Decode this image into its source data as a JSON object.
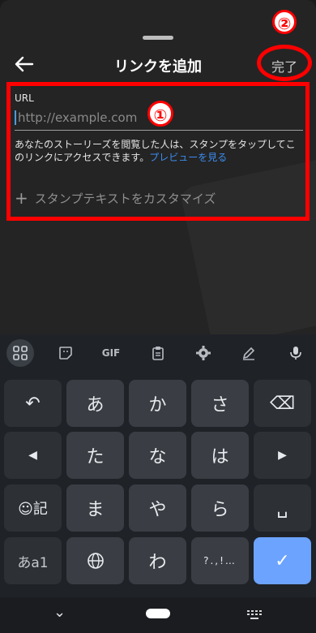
{
  "header": {
    "title": "リンクを追加",
    "done_label": "完了",
    "annotation_2": "②"
  },
  "url_field": {
    "label": "URL",
    "placeholder": "http://example.com",
    "annotation_1": "①"
  },
  "description": {
    "text": "あなたのストーリーズを閲覧した人は、スタンプをタップしてこのリンクにアクセスできます。",
    "link_text": "プレビューを見る"
  },
  "customize": {
    "label": "スタンプテキストをカスタマイズ"
  },
  "keyboard": {
    "toolbar": [
      "grid-icon",
      "sticker-icon",
      "GIF",
      "clipboard-icon",
      "settings-icon",
      "pen-icon",
      "mic-icon"
    ],
    "keys": {
      "undo": "↶",
      "a": "あ",
      "ka": "か",
      "sa": "さ",
      "backspace": "⌫",
      "left": "◀",
      "ta": "た",
      "na": "な",
      "ha": "は",
      "right": "▶",
      "emoji_kigou": "☺記",
      "ma": "ま",
      "ya": "や",
      "ra": "ら",
      "space": "␣",
      "mode": "あa1",
      "globe": "globe-icon",
      "wa": "わ",
      "punct": "?.,!…",
      "enter": "✓"
    }
  },
  "navbar": {
    "back": "⌄",
    "ime": "keyboard-icon"
  }
}
